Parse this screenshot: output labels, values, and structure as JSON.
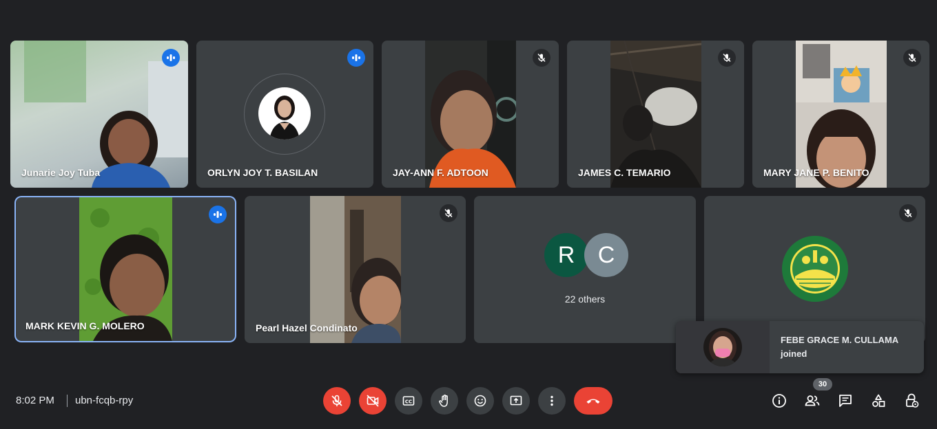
{
  "participants": [
    {
      "name": "Junarie Joy Tuba",
      "state": "speaking"
    },
    {
      "name": "ORLYN JOY T. BASILAN",
      "state": "speaking"
    },
    {
      "name": "JAY-ANN F. ADTOON",
      "state": "muted"
    },
    {
      "name": "JAMES C. TEMARIO",
      "state": "muted"
    },
    {
      "name": "MARY JANE P. BENITO",
      "state": "muted"
    },
    {
      "name": "MARK KEVIN G. MOLERO",
      "state": "speaking"
    },
    {
      "name": "Pearl Hazel Condinato",
      "state": "muted"
    }
  ],
  "others": {
    "initials": [
      "R",
      "C"
    ],
    "label": "22 others",
    "colors": [
      "#0b5741",
      "#7a8a93"
    ]
  },
  "notification": {
    "name": "FEBE GRACE M. CULLAMA",
    "action": "joined"
  },
  "meeting": {
    "time": "8:02 PM",
    "code": "ubn-fcqb-rpy"
  },
  "people_count": "30",
  "colors": {
    "background": "#202124",
    "tile": "#3c4043",
    "accent_blue": "#1a73e8",
    "red": "#ea4335",
    "active_border": "#8ab4f8"
  }
}
